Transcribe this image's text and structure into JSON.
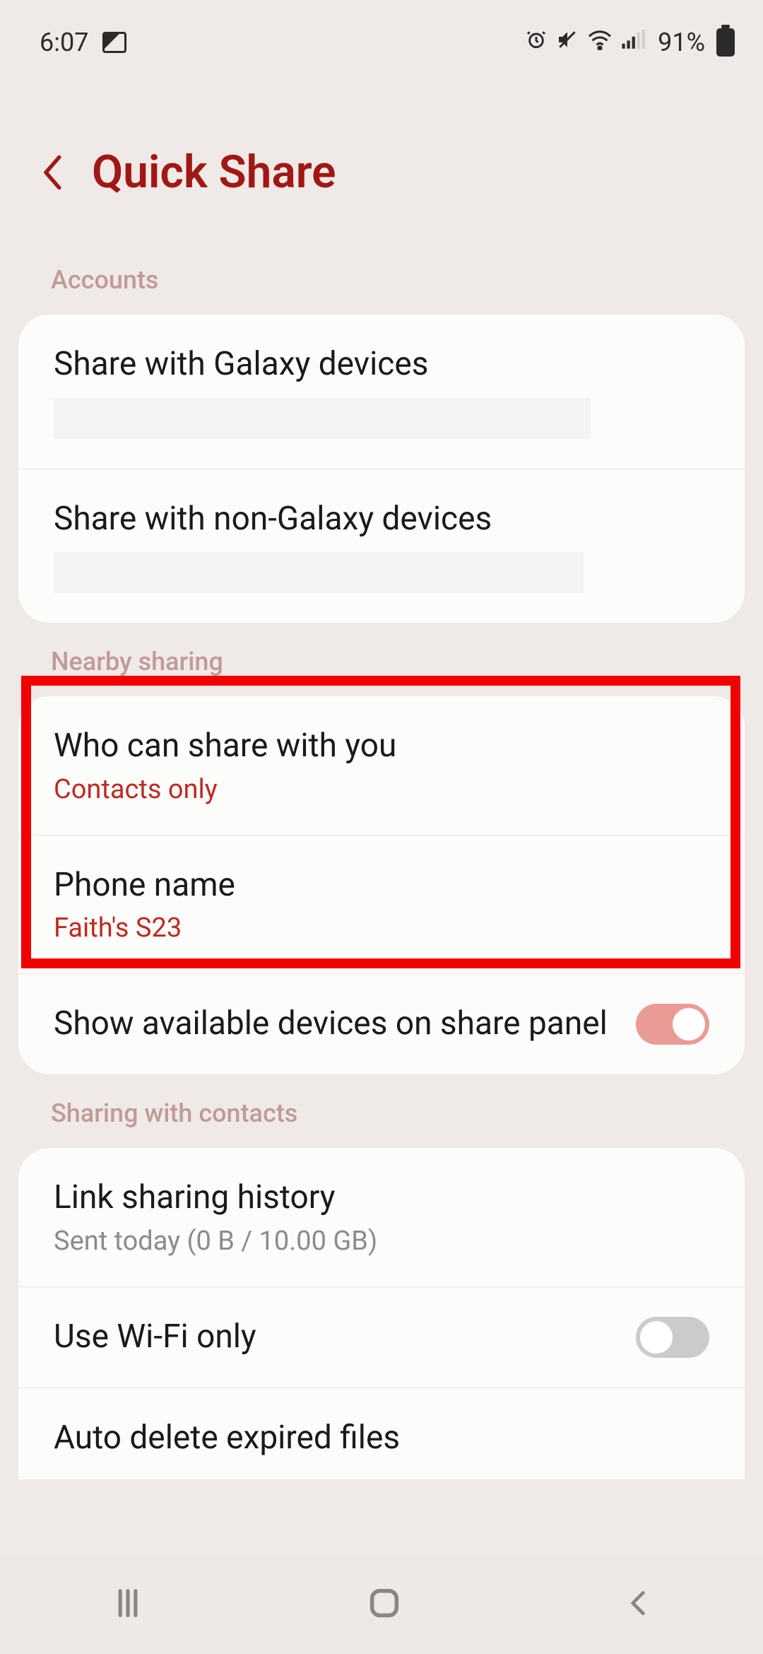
{
  "statusbar": {
    "time": "6:07",
    "battery_pct": "91%"
  },
  "header": {
    "title": "Quick Share"
  },
  "sections": {
    "accounts": {
      "label": "Accounts",
      "share_galaxy": "Share with Galaxy devices",
      "share_non_galaxy": "Share with non-Galaxy devices"
    },
    "nearby": {
      "label": "Nearby sharing",
      "who": {
        "title": "Who can share with you",
        "value": "Contacts only"
      },
      "phone_name": {
        "title": "Phone name",
        "value": "Faith's S23"
      },
      "show_available": "Show available devices on share panel"
    },
    "contacts": {
      "label": "Sharing with contacts",
      "link_history": {
        "title": "Link sharing history",
        "value": "Sent today (0 B / 10.00 GB)"
      },
      "wifi_only": "Use Wi-Fi only",
      "auto_delete": "Auto delete expired files"
    }
  },
  "toggles": {
    "show_available": true,
    "wifi_only": false
  }
}
